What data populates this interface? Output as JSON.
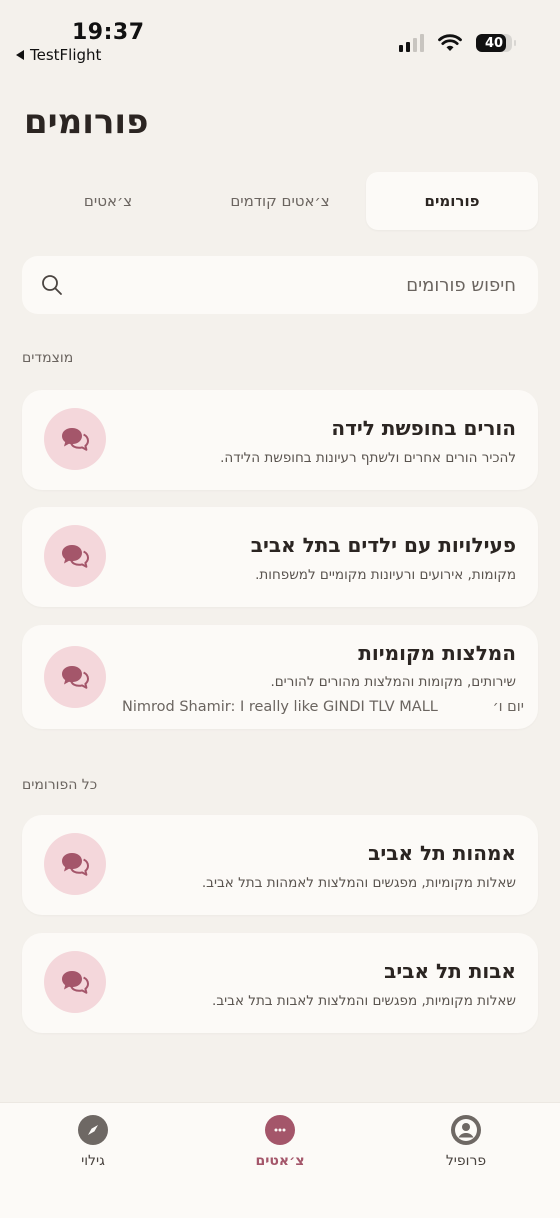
{
  "status": {
    "time": "19:37",
    "back_app": "TestFlight",
    "battery": "40"
  },
  "page": {
    "title": "פורומים"
  },
  "tabs": [
    {
      "label": "פורומים",
      "active": true
    },
    {
      "label": "צ׳אטים קודמים",
      "active": false
    },
    {
      "label": "צ׳אטים",
      "active": false
    }
  ],
  "search": {
    "placeholder": "חיפוש פורומים",
    "value": ""
  },
  "sections": {
    "pinned_label": "מוצמדים",
    "all_label": "כל הפורומים"
  },
  "pinned_forums": [
    {
      "title": "הורים בחופשת לידה",
      "description": "להכיר הורים אחרים ולשתף רעיונות בחופשת הלידה."
    },
    {
      "title": "פעילויות עם ילדים בתל אביב",
      "description": "מקומות, אירועים ורעיונות מקומיים למשפחות."
    },
    {
      "title": "המלצות מקומיות",
      "description": "שירותים, מקומות והמלצות מהורים להורים.",
      "last_message": "Nimrod Shamir: I really like GINDI TLV MALL",
      "last_time": "יום ו׳"
    }
  ],
  "all_forums": [
    {
      "title": "אמהות תל אביב",
      "description": "שאלות מקומיות, מפגשים והמלצות לאמהות בתל אביב."
    },
    {
      "title": "אבות תל אביב",
      "description": "שאלות מקומיות, מפגשים והמלצות לאבות בתל אביב."
    }
  ],
  "nav": {
    "discover": "גילוי",
    "chats": "צ׳אטים",
    "profile": "פרופיל"
  },
  "colors": {
    "accent": "#a4566a",
    "avatar_bg": "#f4d7db",
    "background": "#f4f1ec",
    "card": "#fcfaf7"
  }
}
